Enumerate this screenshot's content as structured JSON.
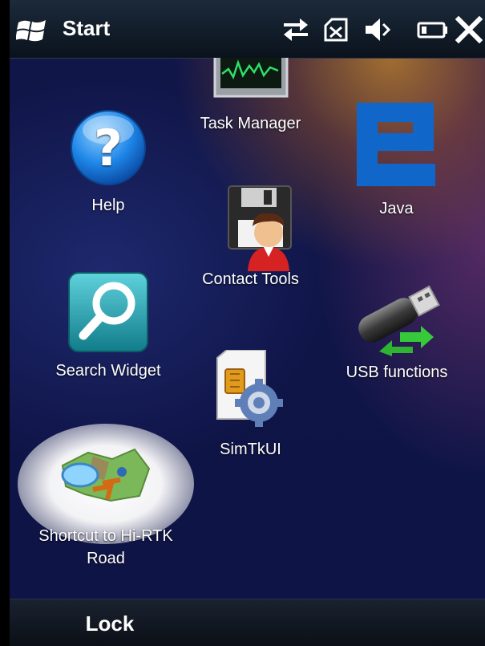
{
  "title_bar": {
    "title": "Start",
    "icons": [
      "windows-flag-icon",
      "connectivity-icon",
      "no-sim-icon",
      "volume-mute-icon",
      "battery-icon",
      "close-icon"
    ]
  },
  "apps": [
    {
      "name": "Task Manager",
      "icon": "task-manager-icon"
    },
    {
      "name": "Help",
      "icon": "help-icon"
    },
    {
      "name": "Java",
      "icon": "java-icon"
    },
    {
      "name": "Contact Tools",
      "icon": "contact-tools-icon"
    },
    {
      "name": "Search Widget",
      "icon": "search-widget-icon"
    },
    {
      "name": "USB functions",
      "icon": "usb-functions-icon"
    },
    {
      "name": "SimTkUI",
      "icon": "simtkui-icon"
    },
    {
      "name": "Shortcut to Hi-RTK Road",
      "icon": "map-icon"
    }
  ],
  "soft_keys": {
    "left": "Lock"
  },
  "colors": {
    "title_bar_bg": "#0a121c",
    "help_blue": "#1e86e8",
    "java_blue": "#1167c9",
    "search_teal": "#1fa7b3"
  }
}
